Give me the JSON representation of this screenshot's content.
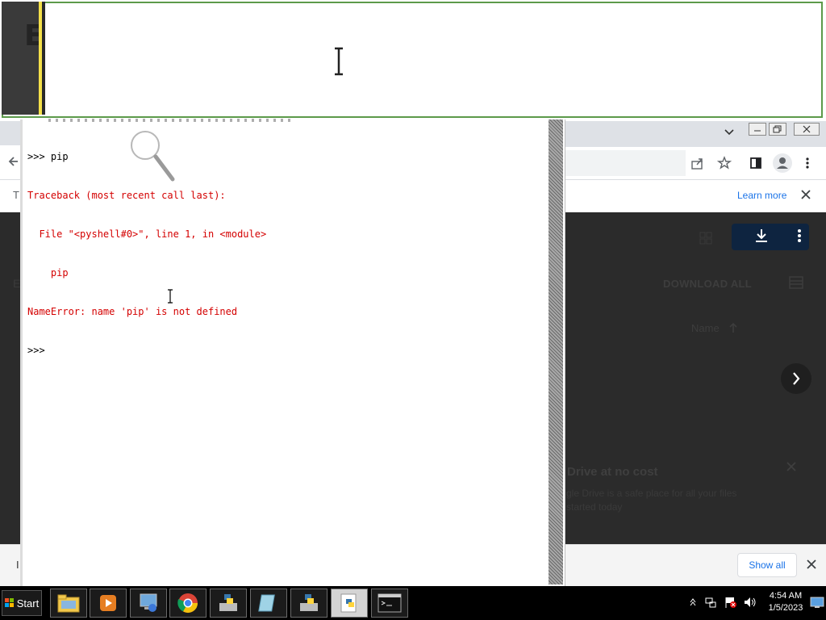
{
  "idle": {
    "lines": [
      {
        "text": ">>> pip",
        "color": "black"
      },
      {
        "text": "Traceback (most recent call last):",
        "color": "red"
      },
      {
        "text": "  File \"<pyshell#0>\", line 1, in <module>",
        "color": "red"
      },
      {
        "text": "    pip",
        "color": "red"
      },
      {
        "text": "NameError: name 'pip' is not defined",
        "color": "red"
      },
      {
        "text": ">>> ",
        "color": "black"
      }
    ]
  },
  "chrome": {
    "learn_more": "Learn more",
    "download_all": "DOWNLOAD ALL",
    "name_header": "Name",
    "promo_title": "Drive at no cost",
    "promo_line1": "gle Drive is a safe place for all your files",
    "promo_line2": "started today",
    "show_all": "Show all",
    "left_letter_t": "T",
    "left_letter_e": "E",
    "left_letter_i": "I"
  },
  "taskbar": {
    "start_label": "Start",
    "time": "4:54 AM",
    "date": "1/5/2023",
    "apps": [
      "explorer-icon",
      "media-player-icon",
      "network-icon",
      "chrome-icon",
      "python-installer-icon",
      "notepad-icon",
      "python-installer-icon",
      "python-idle-icon",
      "cmd-icon"
    ]
  },
  "magnifier": {
    "visible_char": "E"
  },
  "colors": {
    "error_red": "#d40000",
    "magnifier_border": "#5c9a4a",
    "taskbar": "#000000"
  }
}
